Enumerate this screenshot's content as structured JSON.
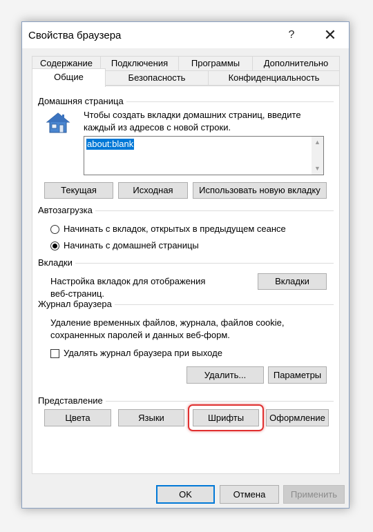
{
  "window": {
    "title": "Свойства браузера",
    "help_symbol": "?",
    "close_symbol": "✕"
  },
  "tabs": {
    "row1": [
      "Содержание",
      "Подключения",
      "Программы",
      "Дополнительно"
    ],
    "row2": [
      "Общие",
      "Безопасность",
      "Конфиденциальность"
    ],
    "active": "Общие"
  },
  "home_page": {
    "section_label": "Домашняя страница",
    "description": "Чтобы создать вкладки домашних страниц, введите каждый из адресов с новой строки.",
    "url_value": "about:blank",
    "buttons": [
      "Текущая",
      "Исходная",
      "Использовать новую вкладку"
    ],
    "icon": "house-icon"
  },
  "startup": {
    "section_label": "Автозагрузка",
    "options": [
      {
        "label": "Начинать с вкладок, открытых в предыдущем сеансе",
        "checked": false
      },
      {
        "label": "Начинать с домашней страницы",
        "checked": true
      }
    ]
  },
  "tabs_section": {
    "section_label": "Вкладки",
    "description": "Настройка вкладок для отображения веб-страниц.",
    "button": "Вкладки"
  },
  "history": {
    "section_label": "Журнал браузера",
    "description": "Удаление временных файлов, журнала, файлов cookie, сохраненных паролей и данных веб-форм.",
    "checkbox_label": "Удалять журнал браузера при выходе",
    "checkbox_checked": false,
    "delete_button": "Удалить...",
    "settings_button": "Параметры"
  },
  "appearance": {
    "section_label": "Представление",
    "buttons": [
      "Цвета",
      "Языки",
      "Шрифты",
      "Оформление"
    ],
    "highlighted": "Шрифты",
    "highlight_color": "#e03030"
  },
  "footer": {
    "ok": "OK",
    "cancel": "Отмена",
    "apply": "Применить"
  },
  "colors": {
    "accent": "#0078d7"
  }
}
